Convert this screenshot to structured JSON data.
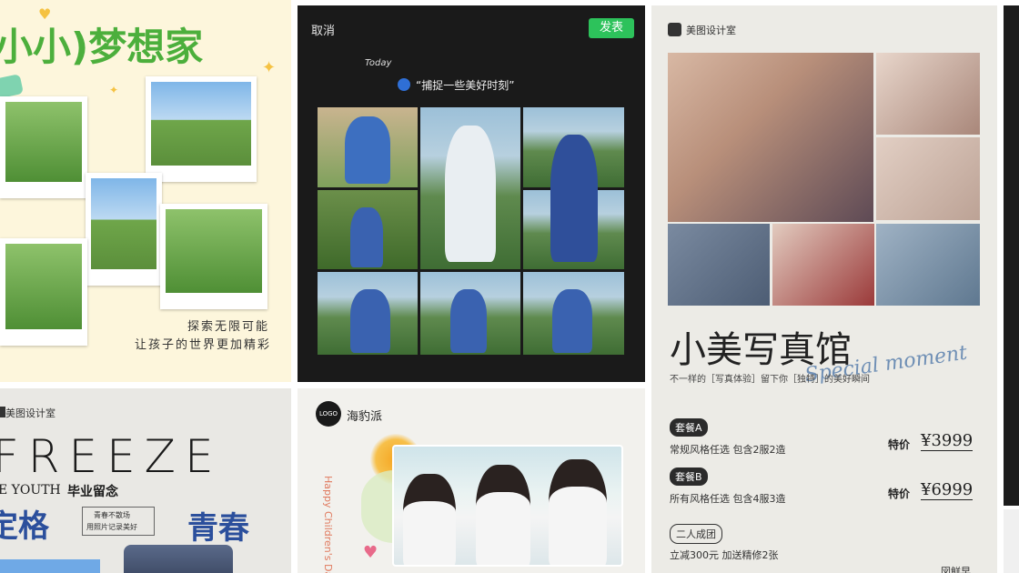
{
  "card1": {
    "title": "小小)梦想家",
    "caption_line1": "探索无限可能",
    "caption_line2": "让孩子的世界更加精彩"
  },
  "card2": {
    "cancel_label": "取消",
    "publish_label": "发表",
    "today_label": "Today",
    "quote": "“捕捉一些美好时刻”"
  },
  "card3": {
    "studio_label": "美图设计室",
    "title": "小美写真馆",
    "script_overlay": "Special moment",
    "subtitle": "不一样的［写真体验］留下你［独特］的美好瞬间",
    "packages": [
      {
        "badge": "套餐A",
        "desc": "常规风格任选 包含2服2造",
        "price_label": "特价",
        "price": "¥3999"
      },
      {
        "badge": "套餐B",
        "desc": "所有风格任选 包含4服3造",
        "price_label": "特价",
        "price": "¥6999"
      }
    ],
    "group_badge": "二人成团",
    "group_desc": "立减300元 加送精修2张",
    "corner_text": "図鲜早"
  },
  "card4": {
    "studio_label": "美图设计室",
    "title": "FREEZE",
    "youth_label": "E YOUTH",
    "graduation_label": "毕业留念",
    "left_big": "定格",
    "stamp_line1": "青春不散场",
    "stamp_line2": "用照片记录美好",
    "right_big": "青春"
  },
  "card5": {
    "logo_label": "LOGO",
    "brand_name": "海豹派",
    "vertical_text": "Happy Children's Day"
  },
  "colors": {
    "card1_bg": "#fdf6dc",
    "card1_title": "#4caf3c",
    "card2_bg": "#1a1a1a",
    "publish_green": "#2dc25b",
    "card3_bg": "#ecebe6",
    "card4_blue": "#2b4f9c",
    "card5_bg": "#f2f1ed"
  }
}
